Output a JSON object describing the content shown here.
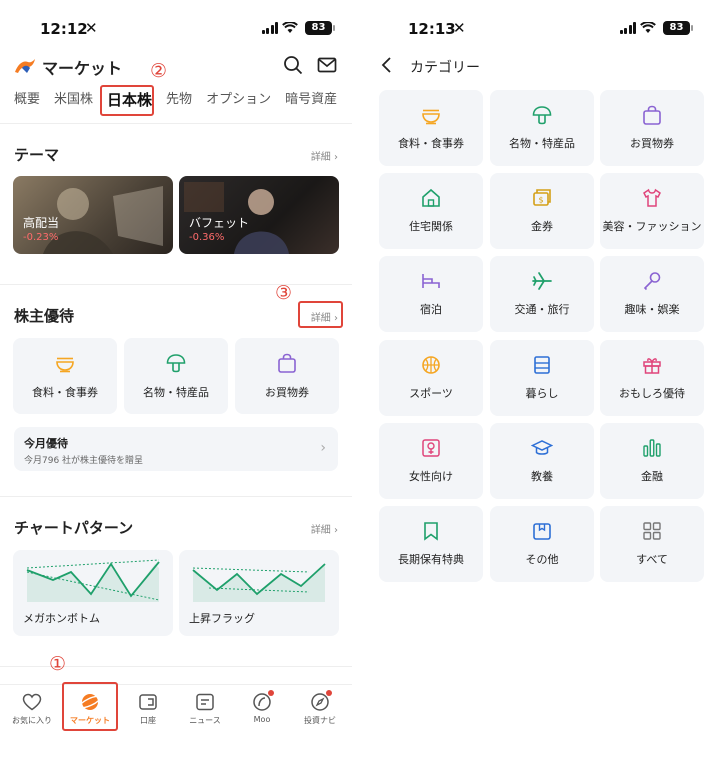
{
  "colors": {
    "accent": "#f57c23",
    "green": "#1fa06b",
    "purple": "#8a63d2",
    "pink": "#e0457b",
    "red": "#e0453a"
  },
  "left": {
    "status": {
      "time": "12:12",
      "battery": "83"
    },
    "header": {
      "title": "マーケット"
    },
    "tabs": [
      "概要",
      "米国株",
      "日本株",
      "先物",
      "オプション",
      "暗号資産"
    ],
    "annotations": {
      "n1": "①",
      "n2": "②",
      "n3": "③"
    },
    "theme": {
      "title": "テーマ",
      "detail": "詳細",
      "cards": [
        {
          "name": "高配当",
          "change": "-0.23%"
        },
        {
          "name": "バフェット",
          "change": "-0.36%"
        }
      ]
    },
    "benefits": {
      "title": "株主優待",
      "detail": "詳細",
      "items": [
        {
          "label": "食料・食事券",
          "icon": "ramen-icon"
        },
        {
          "label": "名物・特産品",
          "icon": "mushroom-icon"
        },
        {
          "label": "お買物券",
          "icon": "shopping-bag-icon"
        }
      ],
      "monthly": {
        "title": "今月優待",
        "subtitle": "今月796 社が株主優待を贈呈"
      }
    },
    "patterns": {
      "title": "チャートパターン",
      "detail": "詳細",
      "items": [
        {
          "label": "メガホンボトム"
        },
        {
          "label": "上昇フラッグ"
        }
      ]
    },
    "nav": [
      {
        "label": "お気に入り",
        "icon": "heart-icon"
      },
      {
        "label": "マーケット",
        "icon": "planet-icon"
      },
      {
        "label": "口座",
        "icon": "wallet-icon"
      },
      {
        "label": "ニュース",
        "icon": "news-icon"
      },
      {
        "label": "Moo",
        "icon": "moo-icon"
      },
      {
        "label": "投資ナビ",
        "icon": "compass-icon"
      }
    ]
  },
  "right": {
    "status": {
      "time": "12:13",
      "battery": "83"
    },
    "header": {
      "title": "カテゴリー"
    },
    "categories": [
      {
        "label": "食料・食事券",
        "icon": "ramen-icon"
      },
      {
        "label": "名物・特産品",
        "icon": "mushroom-icon"
      },
      {
        "label": "お買物券",
        "icon": "shopping-bag-icon"
      },
      {
        "label": "住宅関係",
        "icon": "house-icon"
      },
      {
        "label": "金券",
        "icon": "ticket-icon"
      },
      {
        "label": "美容・ファッション",
        "icon": "tshirt-icon"
      },
      {
        "label": "宿泊",
        "icon": "bed-icon"
      },
      {
        "label": "交通・旅行",
        "icon": "airplane-icon"
      },
      {
        "label": "趣味・娯楽",
        "icon": "microphone-icon"
      },
      {
        "label": "スポーツ",
        "icon": "basketball-icon"
      },
      {
        "label": "暮らし",
        "icon": "cabinet-icon"
      },
      {
        "label": "おもしろ優待",
        "icon": "gift-icon"
      },
      {
        "label": "女性向け",
        "icon": "female-icon"
      },
      {
        "label": "教養",
        "icon": "graduation-cap-icon"
      },
      {
        "label": "金融",
        "icon": "bar-chart-icon"
      },
      {
        "label": "長期保有特典",
        "icon": "bookmark-icon"
      },
      {
        "label": "その他",
        "icon": "box-icon"
      },
      {
        "label": "すべて",
        "icon": "grid-icon"
      }
    ]
  }
}
